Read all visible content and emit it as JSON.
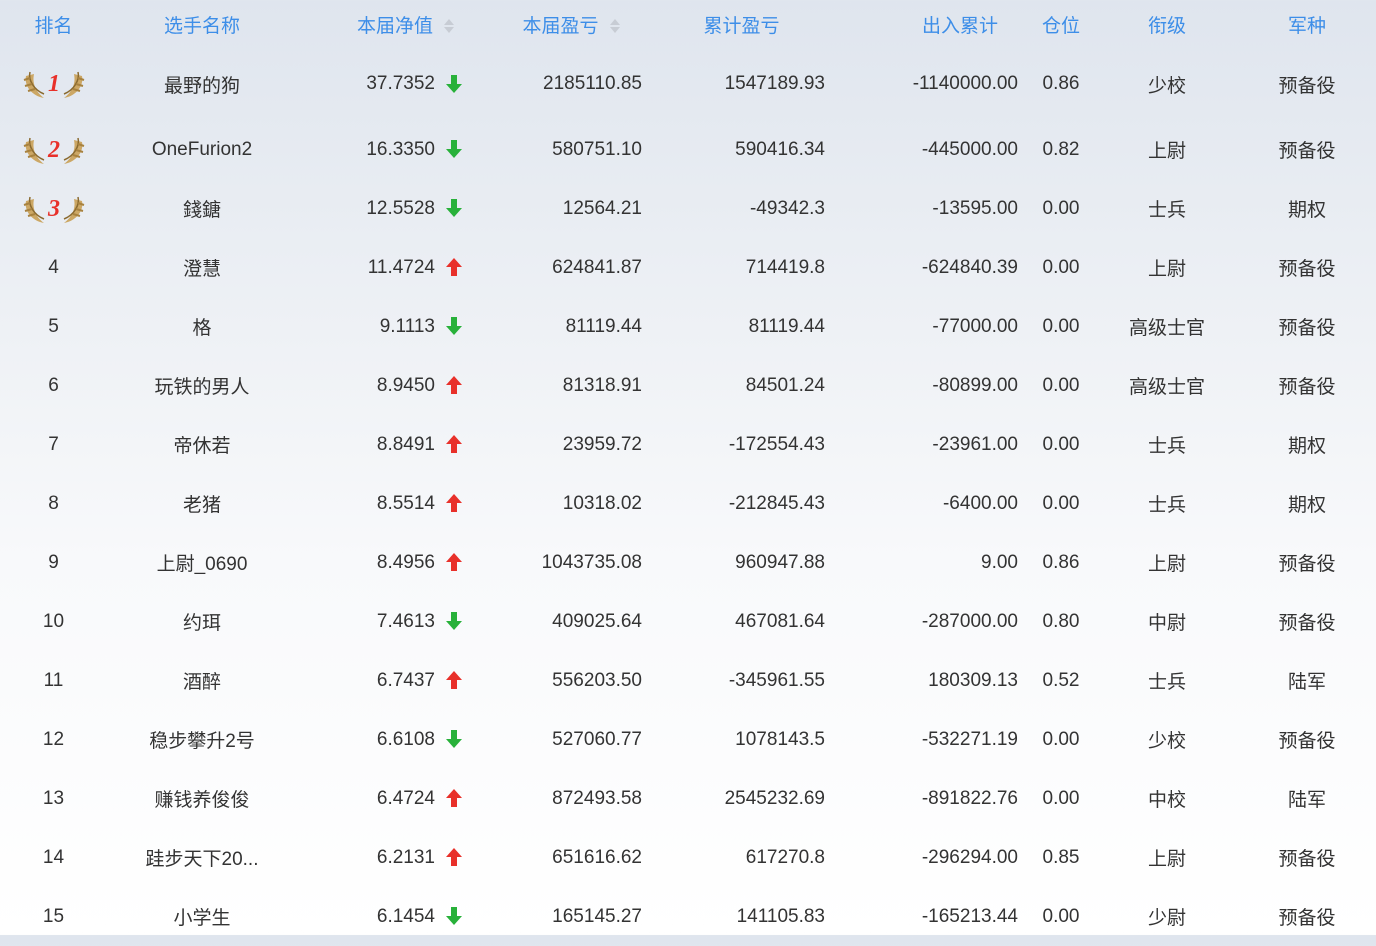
{
  "headers": {
    "rank": "排名",
    "name": "选手名称",
    "net_value": "本届净值",
    "profit": "本届盈亏",
    "cum_profit": "累计盈亏",
    "cum_io": "出入累计",
    "position": "仓位",
    "grade": "衔级",
    "branch": "军种"
  },
  "colors": {
    "header_text": "#3d8ee8",
    "body_text": "#333333",
    "arrow_up": "#e8302a",
    "arrow_down": "#28b13a",
    "medal_red": "#e8302a",
    "wing_gold": "#c9a055"
  },
  "icons": {
    "sort": "sort-icon",
    "up": "arrow-up-icon",
    "down": "arrow-down-icon",
    "medal": "laurel-medal-icon"
  },
  "rows": [
    {
      "rank": "1",
      "name": "最野的狗",
      "net_value": "37.7352",
      "trend": "down",
      "profit": "2185110.85",
      "cum_profit": "1547189.93",
      "cum_io": "-1140000.00",
      "position": "0.86",
      "grade": "少校",
      "branch": "预备役"
    },
    {
      "rank": "2",
      "name": "OneFurion2",
      "net_value": "16.3350",
      "trend": "down",
      "profit": "580751.10",
      "cum_profit": "590416.34",
      "cum_io": "-445000.00",
      "position": "0.82",
      "grade": "上尉",
      "branch": "预备役"
    },
    {
      "rank": "3",
      "name": "錢鎕",
      "net_value": "12.5528",
      "trend": "down",
      "profit": "12564.21",
      "cum_profit": "-49342.3",
      "cum_io": "-13595.00",
      "position": "0.00",
      "grade": "士兵",
      "branch": "期权"
    },
    {
      "rank": "4",
      "name": "澄慧",
      "net_value": "11.4724",
      "trend": "up",
      "profit": "624841.87",
      "cum_profit": "714419.8",
      "cum_io": "-624840.39",
      "position": "0.00",
      "grade": "上尉",
      "branch": "预备役"
    },
    {
      "rank": "5",
      "name": "格",
      "net_value": "9.1113",
      "trend": "down",
      "profit": "81119.44",
      "cum_profit": "81119.44",
      "cum_io": "-77000.00",
      "position": "0.00",
      "grade": "高级士官",
      "branch": "预备役"
    },
    {
      "rank": "6",
      "name": "玩铁的男人",
      "net_value": "8.9450",
      "trend": "up",
      "profit": "81318.91",
      "cum_profit": "84501.24",
      "cum_io": "-80899.00",
      "position": "0.00",
      "grade": "高级士官",
      "branch": "预备役"
    },
    {
      "rank": "7",
      "name": "帝休若",
      "net_value": "8.8491",
      "trend": "up",
      "profit": "23959.72",
      "cum_profit": "-172554.43",
      "cum_io": "-23961.00",
      "position": "0.00",
      "grade": "士兵",
      "branch": "期权"
    },
    {
      "rank": "8",
      "name": "老猪",
      "net_value": "8.5514",
      "trend": "up",
      "profit": "10318.02",
      "cum_profit": "-212845.43",
      "cum_io": "-6400.00",
      "position": "0.00",
      "grade": "士兵",
      "branch": "期权"
    },
    {
      "rank": "9",
      "name": "上尉_0690",
      "net_value": "8.4956",
      "trend": "up",
      "profit": "1043735.08",
      "cum_profit": "960947.88",
      "cum_io": "9.00",
      "position": "0.86",
      "grade": "上尉",
      "branch": "预备役"
    },
    {
      "rank": "10",
      "name": "约珥",
      "net_value": "7.4613",
      "trend": "down",
      "profit": "409025.64",
      "cum_profit": "467081.64",
      "cum_io": "-287000.00",
      "position": "0.80",
      "grade": "中尉",
      "branch": "预备役"
    },
    {
      "rank": "11",
      "name": "酒醉",
      "net_value": "6.7437",
      "trend": "up",
      "profit": "556203.50",
      "cum_profit": "-345961.55",
      "cum_io": "180309.13",
      "position": "0.52",
      "grade": "士兵",
      "branch": "陆军"
    },
    {
      "rank": "12",
      "name": "稳步攀升2号",
      "net_value": "6.6108",
      "trend": "down",
      "profit": "527060.77",
      "cum_profit": "1078143.5",
      "cum_io": "-532271.19",
      "position": "0.00",
      "grade": "少校",
      "branch": "预备役"
    },
    {
      "rank": "13",
      "name": "赚钱养俊俊",
      "net_value": "6.4724",
      "trend": "up",
      "profit": "872493.58",
      "cum_profit": "2545232.69",
      "cum_io": "-891822.76",
      "position": "0.00",
      "grade": "中校",
      "branch": "陆军"
    },
    {
      "rank": "14",
      "name": "跬步天下20...",
      "net_value": "6.2131",
      "trend": "up",
      "profit": "651616.62",
      "cum_profit": "617270.8",
      "cum_io": "-296294.00",
      "position": "0.85",
      "grade": "上尉",
      "branch": "预备役"
    },
    {
      "rank": "15",
      "name": "小学生",
      "net_value": "6.1454",
      "trend": "down",
      "profit": "165145.27",
      "cum_profit": "141105.83",
      "cum_io": "-165213.44",
      "position": "0.00",
      "grade": "少尉",
      "branch": "预备役"
    }
  ]
}
